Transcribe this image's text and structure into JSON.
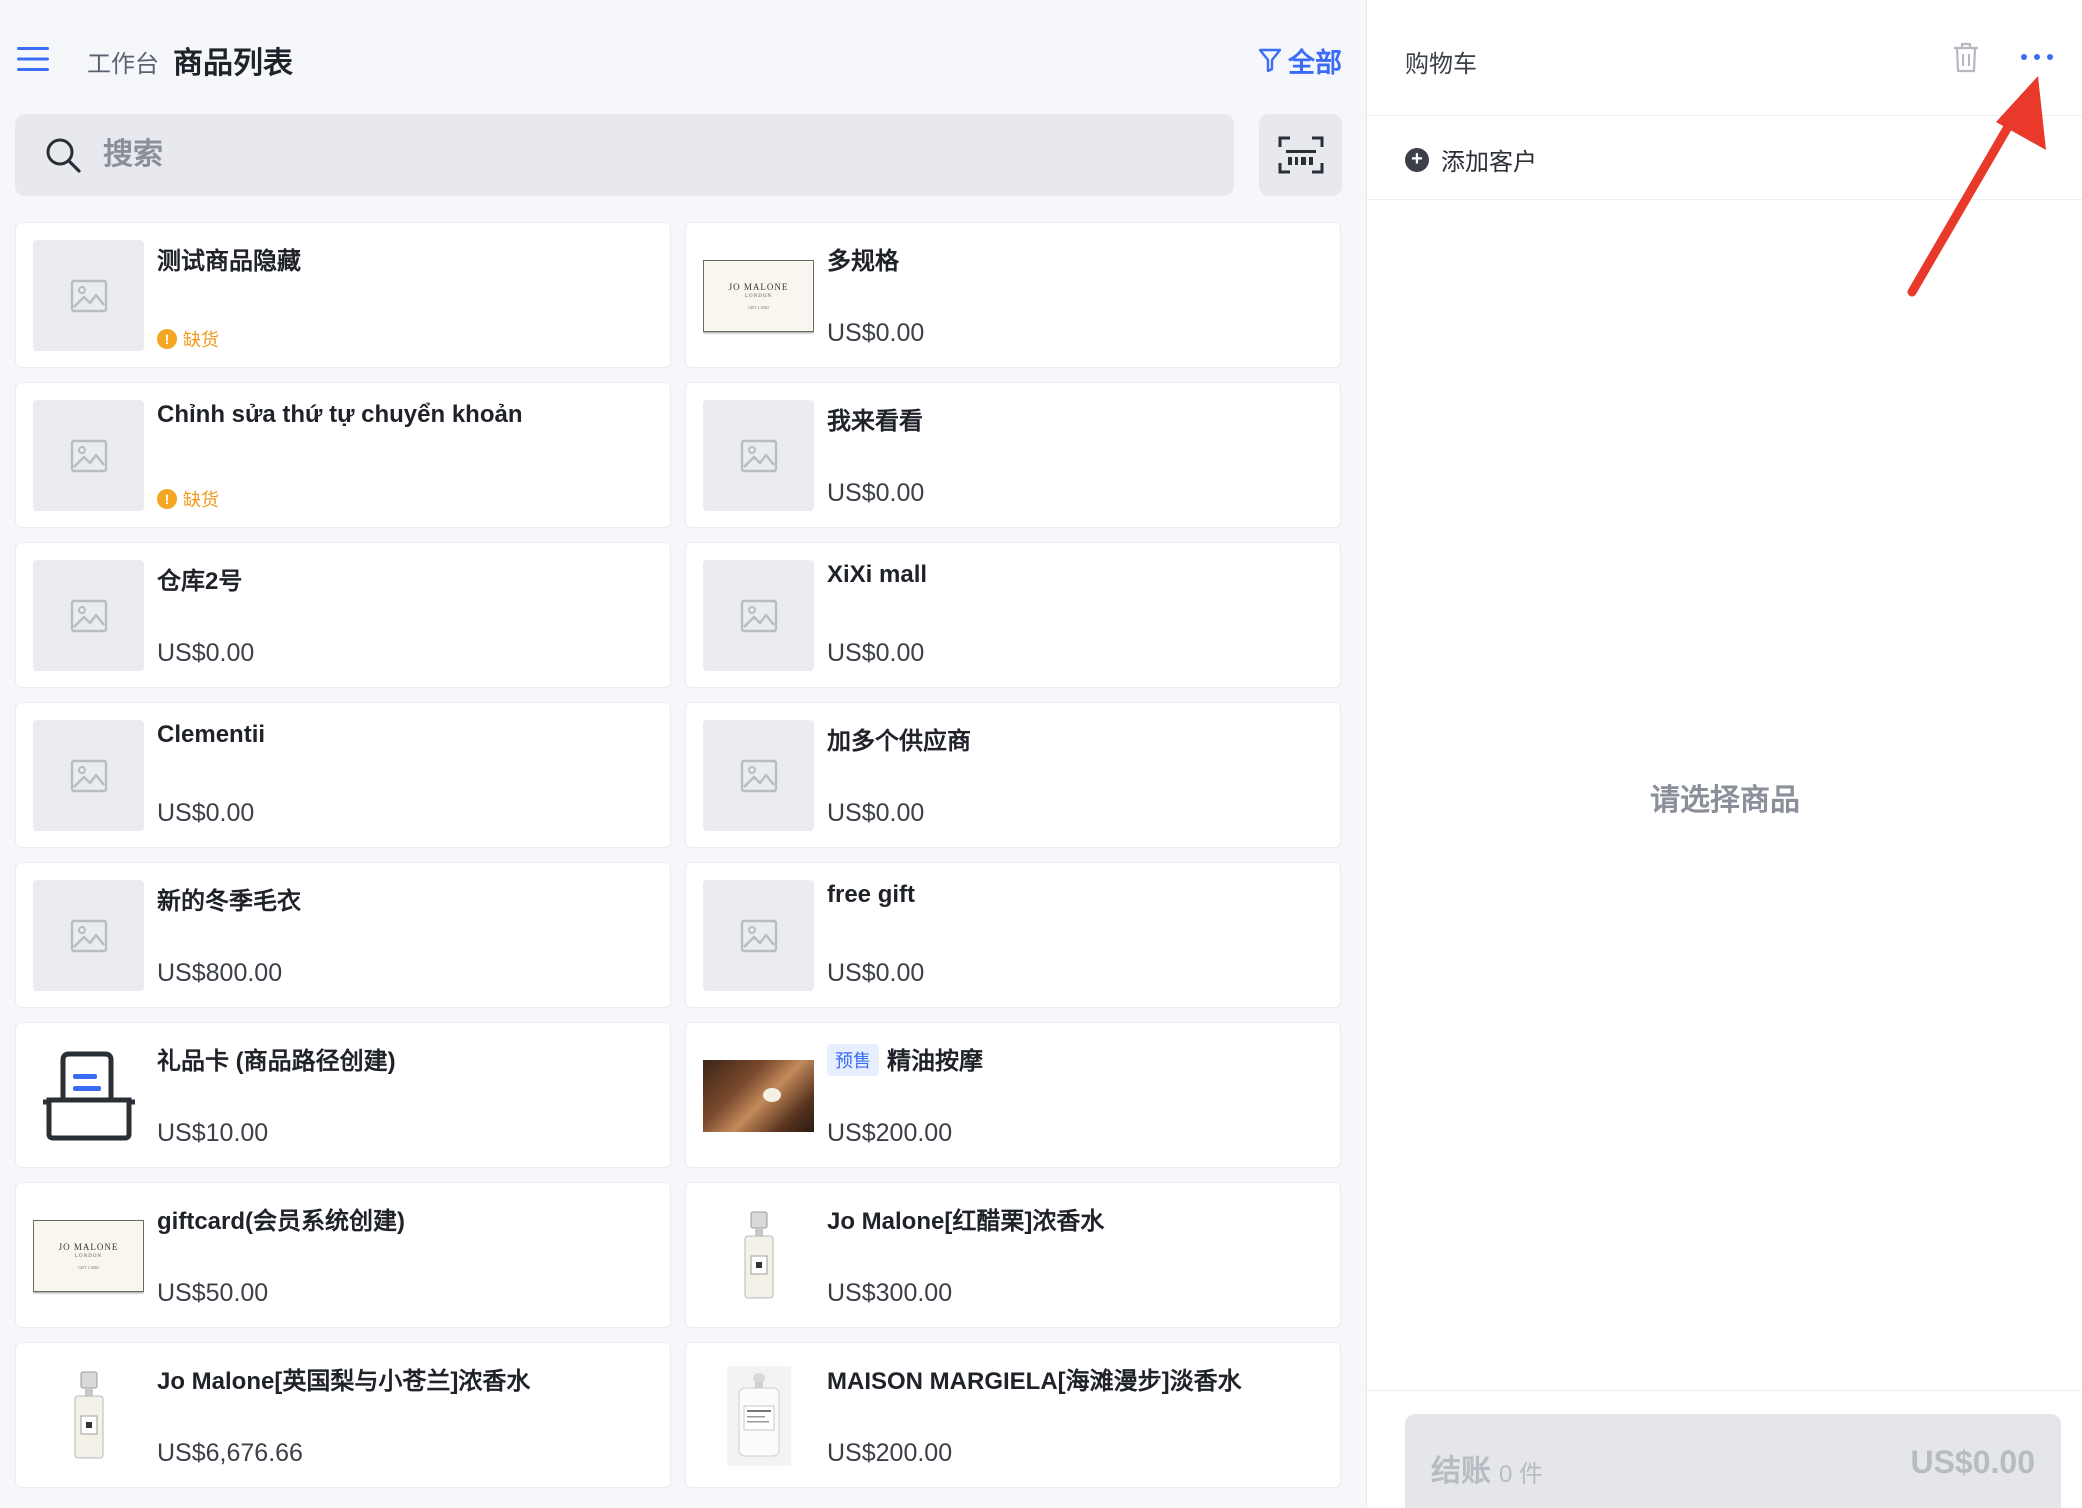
{
  "header": {
    "breadcrumb": "工作台",
    "title": "商品列表",
    "filter_label": "全部"
  },
  "search": {
    "placeholder": "搜索"
  },
  "products": [
    {
      "name": "测试商品隐藏",
      "status": "缺货",
      "image": "placeholder"
    },
    {
      "name": "多规格",
      "price": "US$0.00",
      "image": "jo-malone-box"
    },
    {
      "name": "Chỉnh sửa thứ tự chuyển khoản",
      "status": "缺货",
      "image": "placeholder"
    },
    {
      "name": "我来看看",
      "price": "US$0.00",
      "image": "placeholder"
    },
    {
      "name": "仓库2号",
      "price": "US$0.00",
      "image": "placeholder"
    },
    {
      "name": "XiXi mall",
      "price": "US$0.00",
      "image": "placeholder"
    },
    {
      "name": "Clementii",
      "price": "US$0.00",
      "image": "placeholder"
    },
    {
      "name": "加多个供应商",
      "price": "US$0.00",
      "image": "placeholder"
    },
    {
      "name": "新的冬季毛衣",
      "price": "US$800.00",
      "image": "placeholder"
    },
    {
      "name": "free gift",
      "price": "US$0.00",
      "image": "placeholder"
    },
    {
      "name": "礼品卡 (商品路径创建)",
      "price": "US$10.00",
      "image": "gift-card-icon"
    },
    {
      "name": "精油按摩",
      "tag": "预售",
      "price": "US$200.00",
      "image": "massage-photo"
    },
    {
      "name": "giftcard(会员系统创建)",
      "price": "US$50.00",
      "image": "jo-malone-box"
    },
    {
      "name": "Jo Malone[红醋栗]浓香水",
      "price": "US$300.00",
      "image": "perfume-bottle"
    },
    {
      "name": "Jo Malone[英国梨与小苍兰]浓香水",
      "price": "US$6,676.66",
      "image": "perfume-bottle"
    },
    {
      "name": "MAISON MARGIELA[海滩漫步]淡香水",
      "price": "US$200.00",
      "image": "replica-bottle"
    }
  ],
  "jo_malone_box": {
    "line1": "JO MALONE",
    "line2": "LONDON",
    "line3": "GIFT CARD"
  },
  "cart": {
    "title": "购物车",
    "add_customer": "添加客户",
    "empty_text": "请选择商品",
    "checkout_label": "结账",
    "item_count": "0 件",
    "total": "US$0.00"
  },
  "colors": {
    "accent": "#3b6cf6",
    "warning": "#f5a623",
    "annotation_arrow": "#e8392b"
  }
}
